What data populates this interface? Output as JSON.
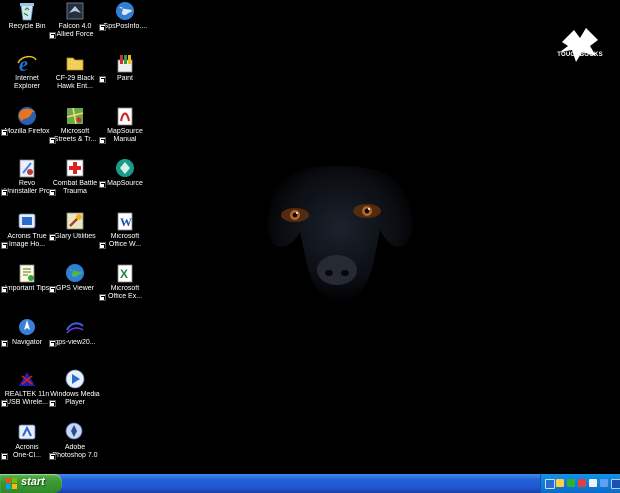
{
  "desktop_icons": [
    {
      "id": "recycle-bin",
      "l1": "Recycle Bin",
      "l2": ""
    },
    {
      "id": "falcon",
      "l1": "Falcon 4.0",
      "l2": "Allied Force"
    },
    {
      "id": "gpsposinfo",
      "l1": "GpsPosInfo....",
      "l2": ""
    },
    {
      "id": "internet-explorer",
      "l1": "Internet",
      "l2": "Explorer"
    },
    {
      "id": "cf29",
      "l1": "CF-29 Black",
      "l2": "Hawk Ent..."
    },
    {
      "id": "paint",
      "l1": "Paint",
      "l2": ""
    },
    {
      "id": "firefox",
      "l1": "Mozilla Firefox",
      "l2": ""
    },
    {
      "id": "ms-streets",
      "l1": "Microsoft",
      "l2": "Streets & Tr..."
    },
    {
      "id": "mapsource-manual",
      "l1": "MapSource",
      "l2": "Manual"
    },
    {
      "id": "revo",
      "l1": "Revo",
      "l2": "Uninstaller Pro"
    },
    {
      "id": "combat-battle",
      "l1": "Combat Battle",
      "l2": "Trauma"
    },
    {
      "id": "mapsource",
      "l1": "MapSource",
      "l2": ""
    },
    {
      "id": "acronis-true-image",
      "l1": "Acronis True",
      "l2": "Image Ho..."
    },
    {
      "id": "glary",
      "l1": "Glary Utilities",
      "l2": ""
    },
    {
      "id": "office-word",
      "l1": "Microsoft",
      "l2": "Office W..."
    },
    {
      "id": "important-tips",
      "l1": "Important Tips",
      "l2": ""
    },
    {
      "id": "gps-viewer",
      "l1": "GPS Viewer",
      "l2": ""
    },
    {
      "id": "office-excel",
      "l1": "Microsoft",
      "l2": "Office Ex..."
    },
    {
      "id": "navigator",
      "l1": "Navigator",
      "l2": ""
    },
    {
      "id": "gps-view",
      "l1": "gps-view20...",
      "l2": ""
    },
    {
      "id": "realtek",
      "l1": "REALTEK 11n",
      "l2": "USB Wirele..."
    },
    {
      "id": "wmp",
      "l1": "Windows Media",
      "l2": "Player"
    },
    {
      "id": "acronis-oneclick",
      "l1": "Acronis",
      "l2": "One-Cl..."
    },
    {
      "id": "photoshop",
      "l1": "Adobe",
      "l2": "Photoshop 7.0"
    }
  ],
  "taskbar": {
    "start_label": "start"
  },
  "branding": {
    "logo_text": "TOUGHBOOKS"
  },
  "colors": {
    "desktop": "#000000",
    "taskbar": "#245edb",
    "start": "#3c9a32",
    "tray": "#0f7fdc"
  }
}
